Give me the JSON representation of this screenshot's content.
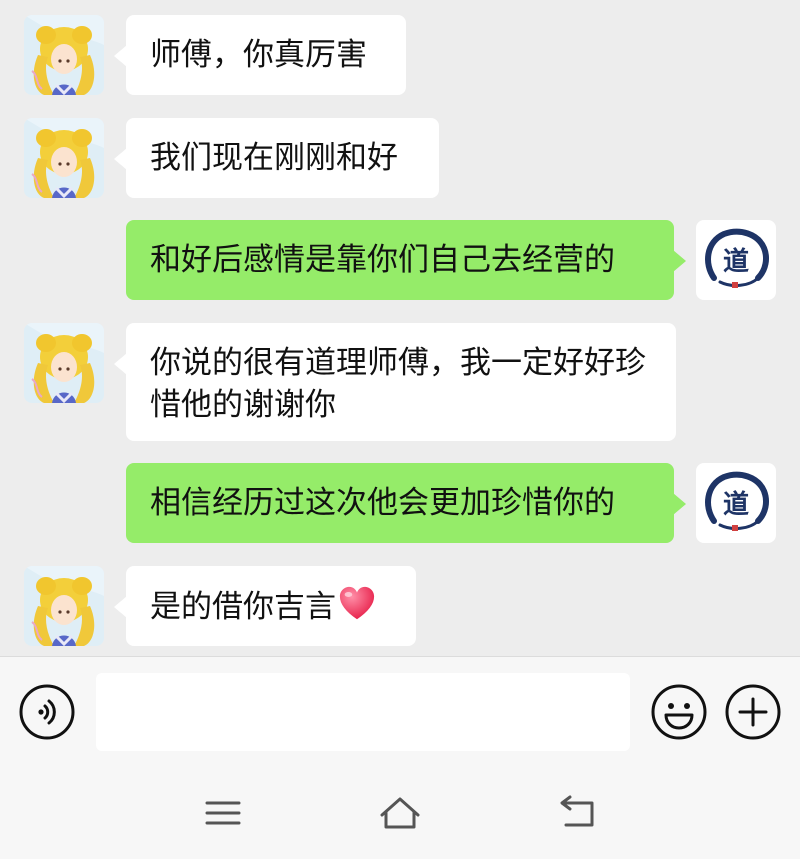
{
  "messages": [
    {
      "side": "in",
      "text": "师傅，你真厉害"
    },
    {
      "side": "in",
      "text": "我们现在刚刚和好"
    },
    {
      "side": "out",
      "text": "和好后感情是靠你们自己去经营的"
    },
    {
      "side": "in",
      "text": "你说的很有道理师傅，我一定好好珍惜他的谢谢你"
    },
    {
      "side": "out",
      "text": "相信经历过这次他会更加珍惜你的"
    },
    {
      "side": "in",
      "text": "是的借你吉言"
    }
  ],
  "avatar_right_glyph": "道",
  "input": {
    "value": ""
  },
  "colors": {
    "background": "#ededed",
    "outgoing": "#95ec69",
    "incoming": "#ffffff"
  },
  "icons": [
    "voice-icon",
    "emoji-icon",
    "plus-icon",
    "menu-icon",
    "home-icon",
    "back-icon",
    "heart-emoji-icon"
  ]
}
